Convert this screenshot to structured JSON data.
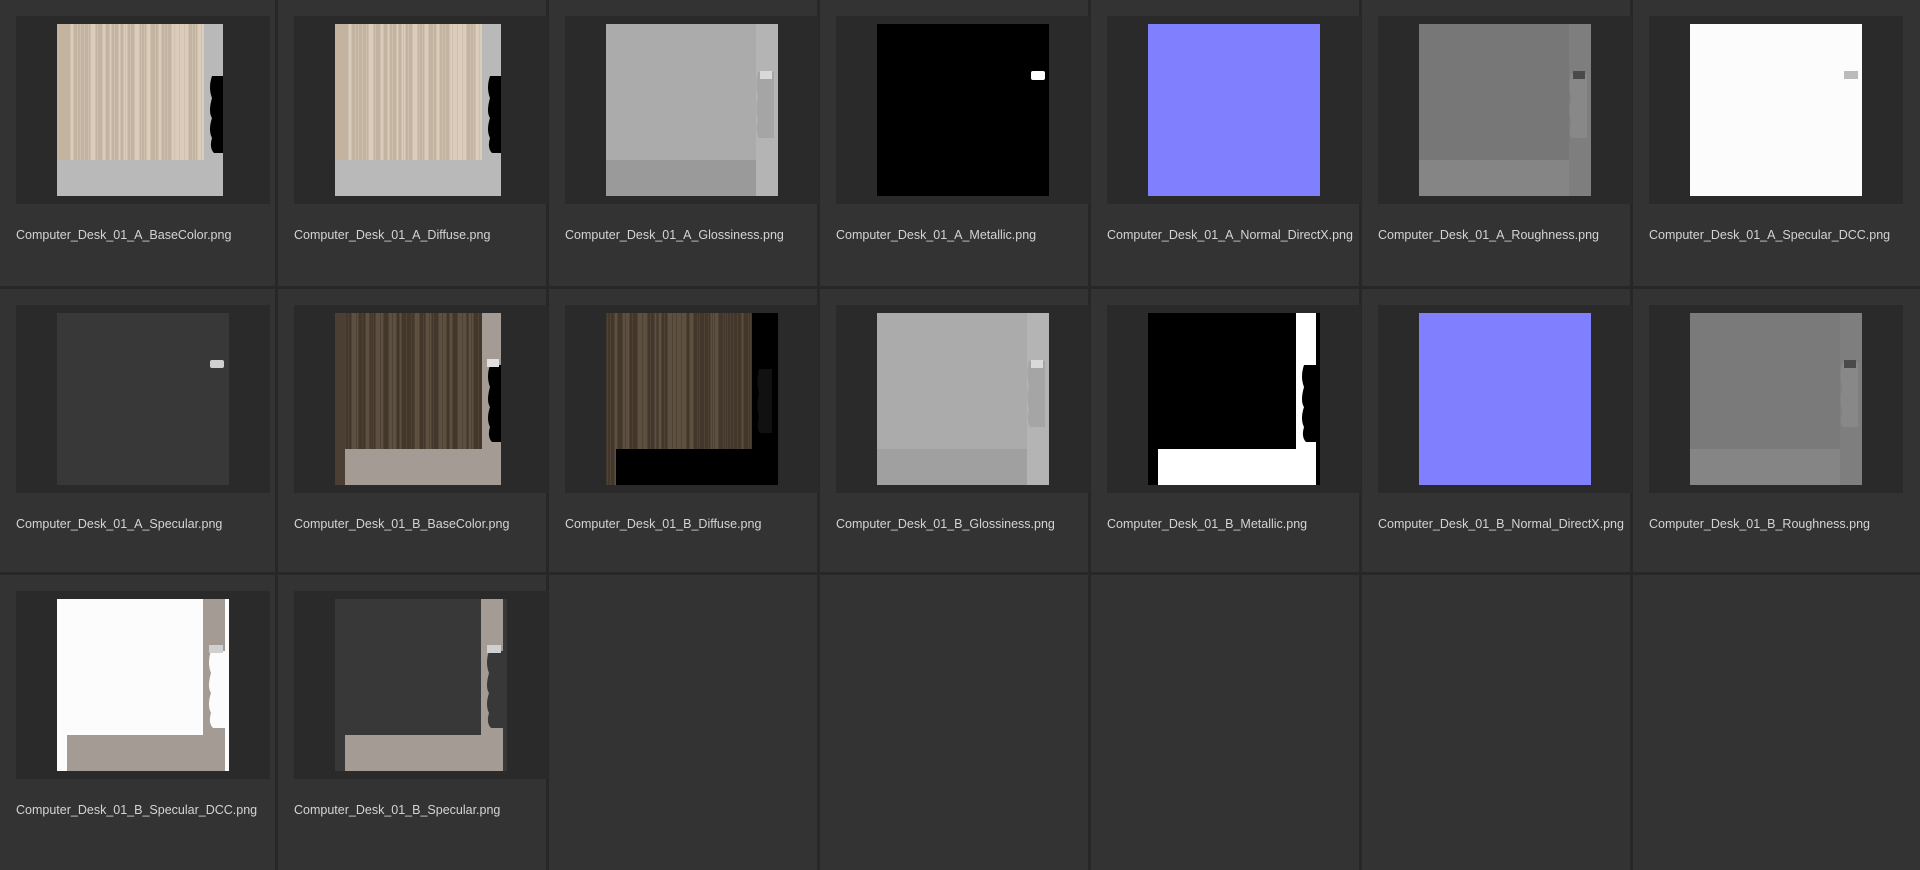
{
  "files": [
    {
      "name": "Computer_Desk_01_A_BaseColor.png",
      "preview": "wood-light"
    },
    {
      "name": "Computer_Desk_01_A_Diffuse.png",
      "preview": "wood-light"
    },
    {
      "name": "Computer_Desk_01_A_Glossiness.png",
      "preview": "gloss-a"
    },
    {
      "name": "Computer_Desk_01_A_Metallic.png",
      "preview": "metallic-a"
    },
    {
      "name": "Computer_Desk_01_A_Normal_DirectX.png",
      "preview": "normal"
    },
    {
      "name": "Computer_Desk_01_A_Roughness.png",
      "preview": "rough-a"
    },
    {
      "name": "Computer_Desk_01_A_Specular_DCC.png",
      "preview": "spec-dcc-a"
    },
    {
      "name": "Computer_Desk_01_A_Specular.png",
      "preview": "spec-a"
    },
    {
      "name": "Computer_Desk_01_B_BaseColor.png",
      "preview": "wood-dark"
    },
    {
      "name": "Computer_Desk_01_B_Diffuse.png",
      "preview": "wood-dark-diffuse"
    },
    {
      "name": "Computer_Desk_01_B_Glossiness.png",
      "preview": "gloss-b"
    },
    {
      "name": "Computer_Desk_01_B_Metallic.png",
      "preview": "metallic-b"
    },
    {
      "name": "Computer_Desk_01_B_Normal_DirectX.png",
      "preview": "normal"
    },
    {
      "name": "Computer_Desk_01_B_Roughness.png",
      "preview": "rough-b"
    },
    {
      "name": "Computer_Desk_01_B_Specular_DCC.png",
      "preview": "spec-dcc-b"
    },
    {
      "name": "Computer_Desk_01_B_Specular.png",
      "preview": "spec-b"
    }
  ],
  "colors": {
    "background": "#333333",
    "frame": "#2a2a2a",
    "divider": "#272727",
    "label": "#d4d4d4",
    "normal_map": "#8080ff"
  }
}
